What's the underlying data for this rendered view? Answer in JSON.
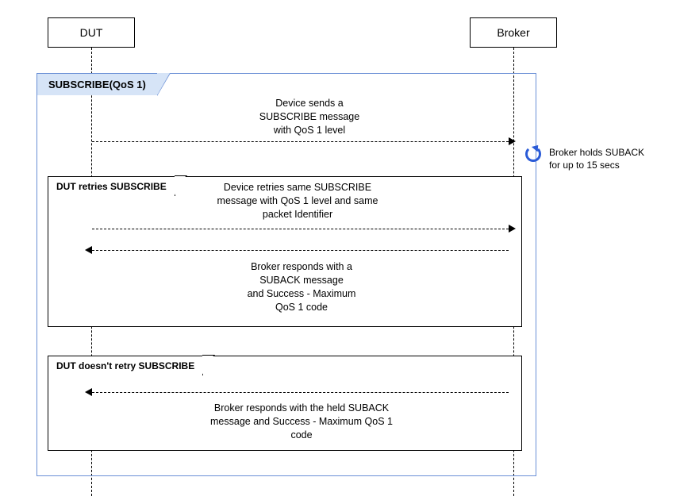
{
  "actors": {
    "dut": "DUT",
    "broker": "Broker"
  },
  "outer_frame": {
    "label": "SUBSCRIBE(QoS 1)"
  },
  "messages": {
    "m1": "Device sends a\nSUBSCRIBE message\nwith QoS 1 level",
    "m2": "Device retries same SUBSCRIBE\nmessage with QoS 1 level and same\npacket Identifier",
    "m3": "Broker responds with a\nSUBACK message\nand Success - Maximum\nQoS 1  code",
    "m4": "Broker responds with the held SUBACK\nmessage and Success - Maximum QoS 1\ncode"
  },
  "frames": {
    "retry": "DUT retries SUBSCRIBE",
    "noretry": "DUT doesn't retry SUBSCRIBE"
  },
  "side_note": "Broker holds SUBACK\nfor up to 15 secs",
  "chart_data": {
    "type": "sequence_diagram",
    "participants": [
      "DUT",
      "Broker"
    ],
    "blocks": [
      {
        "label": "SUBSCRIBE(QoS 1)",
        "steps": [
          {
            "from": "DUT",
            "to": "Broker",
            "text": "Device sends a SUBSCRIBE message with QoS 1 level",
            "style": "dashed"
          },
          {
            "at": "Broker",
            "type": "note",
            "text": "Broker holds SUBACK for up to 15 secs"
          },
          {
            "type": "alt",
            "branches": [
              {
                "label": "DUT retries SUBSCRIBE",
                "steps": [
                  {
                    "from": "DUT",
                    "to": "Broker",
                    "text": "Device retries same SUBSCRIBE message with QoS 1 level and same packet Identifier",
                    "style": "dashed"
                  },
                  {
                    "from": "Broker",
                    "to": "DUT",
                    "text": "Broker responds with a SUBACK message and Success - Maximum QoS 1 code",
                    "style": "dashed"
                  }
                ]
              },
              {
                "label": "DUT doesn't retry SUBSCRIBE",
                "steps": [
                  {
                    "from": "Broker",
                    "to": "DUT",
                    "text": "Broker responds with the held SUBACK message and Success - Maximum QoS 1 code",
                    "style": "dashed"
                  }
                ]
              }
            ]
          }
        ]
      }
    ]
  }
}
